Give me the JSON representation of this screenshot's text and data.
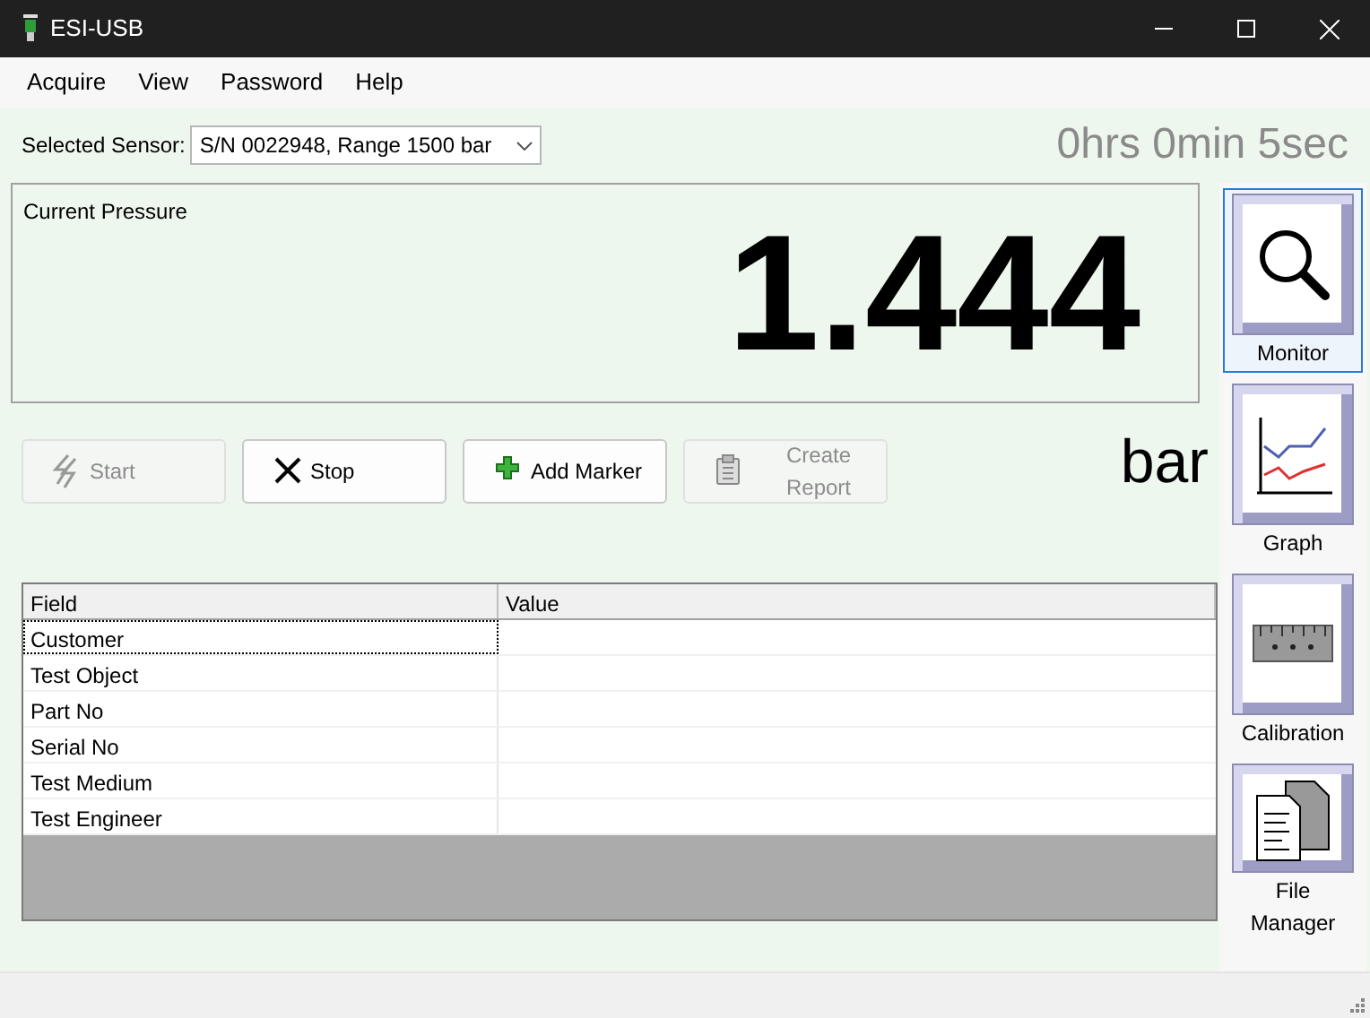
{
  "window": {
    "title": "ESI-USB"
  },
  "menu": [
    {
      "label": "Acquire"
    },
    {
      "label": "View"
    },
    {
      "label": "Password"
    },
    {
      "label": "Help"
    }
  ],
  "sensor": {
    "label": "Selected Sensor:",
    "value": "S/N 0022948, Range 1500 bar"
  },
  "elapsed": "0hrs 0min 5sec",
  "pressure": {
    "label": "Current Pressure",
    "reading": "1.444",
    "unit": "bar"
  },
  "actions": [
    {
      "label": "Start",
      "kind": "start",
      "disabled": true
    },
    {
      "label": "Stop",
      "kind": "stop",
      "disabled": false
    },
    {
      "label": "Add Marker",
      "kind": "marker",
      "disabled": false
    },
    {
      "label": "Create Report",
      "kind": "report",
      "disabled": true
    }
  ],
  "table": {
    "columns": [
      "Field",
      "Value"
    ],
    "rows": [
      {
        "field": "Customer",
        "focused": true
      },
      {
        "field": "Test Object",
        "focused": false
      },
      {
        "field": "Part No",
        "focused": false
      },
      {
        "field": "Serial No",
        "focused": false
      },
      {
        "field": "Test Medium",
        "focused": false
      },
      {
        "field": "Test Engineer",
        "focused": false
      }
    ]
  },
  "nav": [
    {
      "label": "Monitor",
      "kind": "monitor",
      "selected": true
    },
    {
      "label": "Graph",
      "kind": "graph",
      "selected": false
    },
    {
      "label": "Calibration",
      "kind": "calibration",
      "selected": false
    },
    {
      "label": "File Manager",
      "kind": "files",
      "selected": false
    }
  ]
}
